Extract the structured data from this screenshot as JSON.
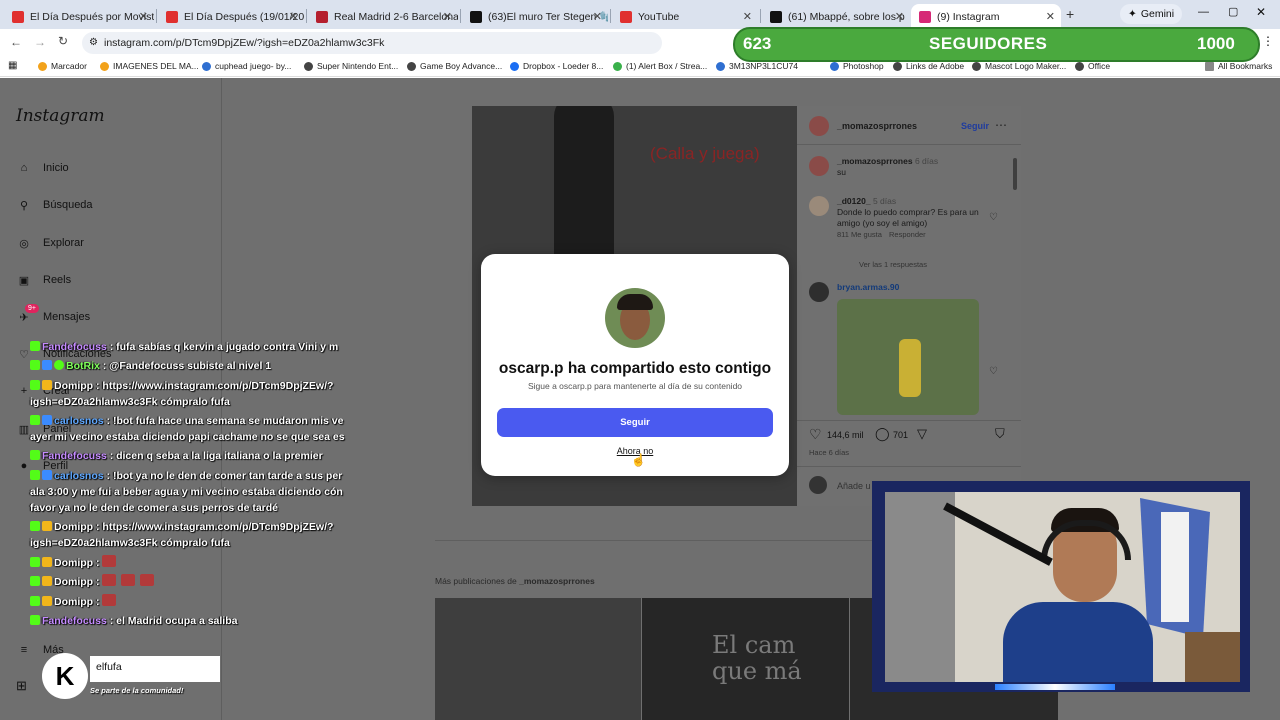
{
  "tabs": [
    {
      "label": "El Día Después por Movistar",
      "color": "#e0302f"
    },
    {
      "label": "El Día Después (19/01/2026)",
      "color": "#e0302f"
    },
    {
      "label": "Real Madrid 2-6 Barcelona (",
      "color": "#b51f2e"
    },
    {
      "label": "(63)El muro Ter Stegen 🧤#ta",
      "color": "#111111"
    },
    {
      "label": "YouTube",
      "color": "#e0302f"
    },
    {
      "label": "(61) Mbappé, sobre los p",
      "color": "#111111"
    },
    {
      "label": "(9) Instagram",
      "color": "#d62976"
    },
    {
      "label": "Gemini",
      "color": "#4a6cf7"
    }
  ],
  "address": "instagram.com/p/DTcm9DpjZEw/?igsh=eDZ0a2hlamw3c3Fk",
  "bookmarks": [
    "Marcador",
    "IMAGENES DEL MA...",
    "cuphead juego- by...",
    "Super Nintendo Ent...",
    "Game Boy Advance...",
    "Dropbox - Loeder 8...",
    "(1) Alert Box / Strea...",
    "3M13NP3L1CU74",
    "Photoshop",
    "Links de Adobe",
    "Mascot Logo Maker...",
    "Office",
    "All Bookmarks"
  ],
  "followers": {
    "count": "623",
    "label": "SEGUIDORES",
    "goal": "1000"
  },
  "sidebar": {
    "logo": "Instagram",
    "items": [
      "Inicio",
      "Búsqueda",
      "Explorar",
      "Reels",
      "Mensajes",
      "Notificaciones",
      "Crear",
      "Panel",
      "Perfil",
      "Más"
    ],
    "messages_badge": "9+"
  },
  "post": {
    "overlay_text": "(Calla y juega)",
    "author": "_momazosprrones",
    "follow": "Seguir",
    "comments": [
      {
        "user": "_momazosprrones",
        "time": "6 días",
        "text": "su"
      },
      {
        "user": "_d0120_",
        "time": "5 días",
        "text": "Donde lo puedo comprar? Es para un amigo (yo soy el amigo)",
        "likes": "811 Me gusta",
        "reply": "Responder",
        "view_replies": "Ver las 1 respuestas"
      },
      {
        "user": "bryan.armas.90",
        "time": "",
        "text": ""
      }
    ],
    "likes": "144,6 mil",
    "comment_count": "701",
    "age": "Hace 6 días",
    "add_comment": "Añade u",
    "more_from": "Más publicaciones de",
    "more_user": "_momazosprrones"
  },
  "dialog": {
    "title": "oscarp.p ha compartido esto contigo",
    "subtitle": "Sigue a oscarp.p para mantenerte al día de su contenido",
    "follow_button": "Seguir",
    "dismiss": "Ahora no"
  },
  "chat": [
    {
      "user": "Fandefocuss",
      "color": "purple",
      "text": ": fufa sabías q kervin a jugado contra Vini y m"
    },
    {
      "user": "BotRix",
      "color": "green",
      "text": ": @Fandefocuss subiste al nivel 1"
    },
    {
      "user": "Domipp",
      "color": "white",
      "text": ": https://www.instagram.com/p/DTcm9DpjZEw/?"
    },
    {
      "user": "",
      "color": "white",
      "text": "igsh=eDZ0a2hlamw3c3Fk cómpralo fufa"
    },
    {
      "user": "carlosnos",
      "color": "blue",
      "text": ": !bot fufa hace una semana se mudaron mis ve"
    },
    {
      "user": "",
      "color": "white",
      "text": "ayer mi vecino estaba diciendo papi cachame no se que sea es"
    },
    {
      "user": "Fandefocuss",
      "color": "purple",
      "text": ": dicen q seba a la liga italiana o la premier"
    },
    {
      "user": "carlosnos",
      "color": "blue",
      "text": ": !bot ya no le den de comer tan tarde a sus per"
    },
    {
      "user": "",
      "color": "white",
      "text": "ala 3:00 y me fui a beber agua y mi vecino estaba diciendo cón"
    },
    {
      "user": "",
      "color": "white",
      "text": "favor ya no le den de comer a sus perros de tardé"
    },
    {
      "user": "Domipp",
      "color": "white",
      "text": ": https://www.instagram.com/p/DTcm9DpjZEw/?"
    },
    {
      "user": "",
      "color": "white",
      "text": "igsh=eDZ0a2hlamw3c3Fk cómpralo fufa"
    },
    {
      "user": "Domipp",
      "color": "white",
      "text": ":"
    },
    {
      "user": "Domipp",
      "color": "white",
      "text": ":"
    },
    {
      "user": "Domipp",
      "color": "white",
      "text": ":"
    },
    {
      "user": "Fandefocuss",
      "color": "purple",
      "text": ": el Madrid ocupa a saliba"
    }
  ],
  "kick": {
    "user": "elfufa",
    "tagline": "Se parte de la comunidad!"
  }
}
